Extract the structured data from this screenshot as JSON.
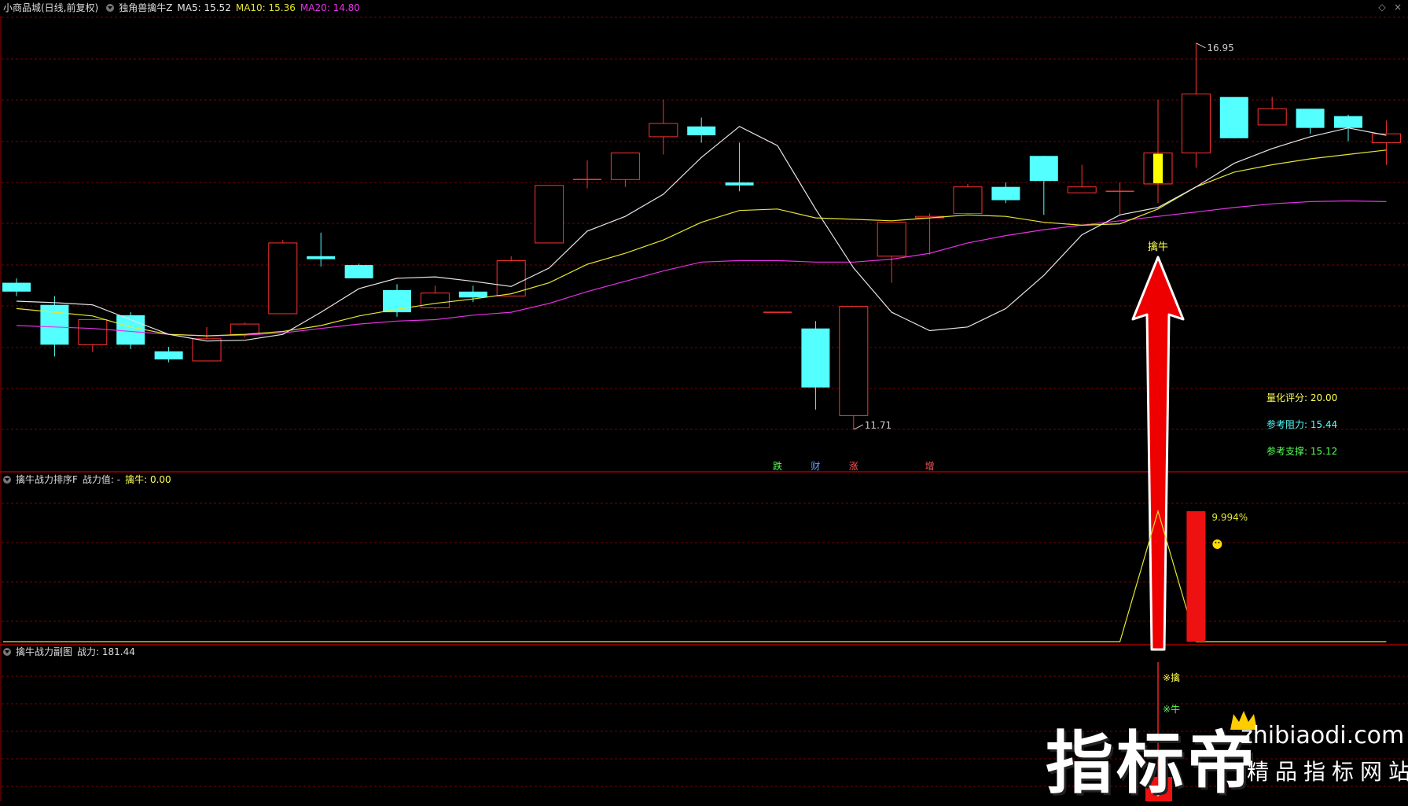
{
  "header": {
    "stock_name": "小商品城(日线,前复权)",
    "indicator_name": "独角兽擒牛Z",
    "ma5": "MA5: 15.52",
    "ma10": "MA10: 15.36",
    "ma20": "MA20: 14.80"
  },
  "panel2_header": {
    "name": "擒牛战力排序F",
    "value_label": "战力值: -",
    "qinniu_label": "擒牛: 0.00"
  },
  "panel3_header": {
    "name": "擒牛战力副图",
    "value_label": "战力: 181.44"
  },
  "price_labels": {
    "high": "16.95",
    "low": "11.71"
  },
  "signal_label": "擒牛",
  "event_labels": [
    "跌",
    "财",
    "涨",
    "增"
  ],
  "right_info": [
    {
      "label": "量化评分: 20.00",
      "color": "#ffff55"
    },
    {
      "label": "参考阻力: 15.44",
      "color": "#55ffff"
    },
    {
      "label": "参考支撑: 15.12",
      "color": "#55ff55"
    }
  ],
  "panel2_pct": "9.994%",
  "panel3_marks": [
    "※擒",
    "※牛"
  ],
  "watermark": {
    "main": "指标帝",
    "url": "zhibiaodi.com",
    "sub": "精品指标网站"
  },
  "colors": {
    "up": "#ff3232",
    "down": "#54ffff",
    "ma5": "#e6e6e6",
    "ma10": "#e6e632",
    "ma20": "#e632e6",
    "grid": "#7a0000",
    "signal": "#ffff00"
  },
  "chart_data": {
    "type": "candlestick",
    "candles": [
      {
        "o": 13.7,
        "h": 13.76,
        "l": 13.52,
        "c": 13.58
      },
      {
        "o": 13.4,
        "h": 13.52,
        "l": 12.7,
        "c": 12.86
      },
      {
        "o": 12.86,
        "h": 13.2,
        "l": 12.76,
        "c": 13.2
      },
      {
        "o": 13.26,
        "h": 13.3,
        "l": 12.8,
        "c": 12.86
      },
      {
        "o": 12.77,
        "h": 12.83,
        "l": 12.62,
        "c": 12.66
      },
      {
        "o": 12.64,
        "h": 13.1,
        "l": 12.64,
        "c": 12.94
      },
      {
        "o": 13.0,
        "h": 13.16,
        "l": 12.96,
        "c": 13.14
      },
      {
        "o": 13.28,
        "h": 14.28,
        "l": 13.28,
        "c": 14.24
      },
      {
        "o": 14.06,
        "h": 14.38,
        "l": 13.92,
        "c": 14.02
      },
      {
        "o": 13.94,
        "h": 13.96,
        "l": 13.76,
        "c": 13.76
      },
      {
        "o": 13.6,
        "h": 13.68,
        "l": 13.24,
        "c": 13.3
      },
      {
        "o": 13.36,
        "h": 13.66,
        "l": 13.34,
        "c": 13.56
      },
      {
        "o": 13.58,
        "h": 13.66,
        "l": 13.44,
        "c": 13.5
      },
      {
        "o": 13.52,
        "h": 14.06,
        "l": 13.52,
        "c": 14.0
      },
      {
        "o": 14.24,
        "h": 15.02,
        "l": 14.24,
        "c": 15.02
      },
      {
        "o": 15.1,
        "h": 15.36,
        "l": 14.98,
        "c": 15.1
      },
      {
        "o": 15.1,
        "h": 15.46,
        "l": 15.0,
        "c": 15.46
      },
      {
        "o": 15.68,
        "h": 16.18,
        "l": 15.44,
        "c": 15.86
      },
      {
        "o": 15.82,
        "h": 15.94,
        "l": 15.6,
        "c": 15.7
      },
      {
        "o": 15.06,
        "h": 15.6,
        "l": 14.94,
        "c": 15.02
      },
      {
        "o": 13.3,
        "h": 13.3,
        "l": 13.3,
        "c": 13.3
      },
      {
        "o": 13.08,
        "h": 13.18,
        "l": 11.98,
        "c": 12.28
      },
      {
        "o": 11.9,
        "h": 13.38,
        "l": 11.71,
        "c": 13.38
      },
      {
        "o": 14.06,
        "h": 14.52,
        "l": 13.7,
        "c": 14.52
      },
      {
        "o": 14.58,
        "h": 14.64,
        "l": 14.08,
        "c": 14.6
      },
      {
        "o": 14.64,
        "h": 15.04,
        "l": 14.64,
        "c": 15.0
      },
      {
        "o": 15.0,
        "h": 15.06,
        "l": 14.78,
        "c": 14.82
      },
      {
        "o": 15.42,
        "h": 15.42,
        "l": 14.62,
        "c": 15.08
      },
      {
        "o": 14.92,
        "h": 15.3,
        "l": 14.92,
        "c": 15.0
      },
      {
        "o": 14.94,
        "h": 15.06,
        "l": 14.62,
        "c": 14.94
      },
      {
        "o": 15.04,
        "h": 16.18,
        "l": 14.78,
        "c": 15.46
      },
      {
        "o": 15.46,
        "h": 16.95,
        "l": 15.26,
        "c": 16.26
      },
      {
        "o": 16.22,
        "h": 16.22,
        "l": 15.66,
        "c": 15.66
      },
      {
        "o": 15.84,
        "h": 16.22,
        "l": 15.84,
        "c": 16.06
      },
      {
        "o": 16.06,
        "h": 16.06,
        "l": 15.72,
        "c": 15.8
      },
      {
        "o": 15.96,
        "h": 15.98,
        "l": 15.62,
        "c": 15.8
      },
      {
        "o": 15.6,
        "h": 15.9,
        "l": 15.3,
        "c": 15.72
      }
    ],
    "ma5": [
      13.45,
      13.43,
      13.4,
      13.2,
      13.0,
      12.91,
      12.92,
      13.0,
      13.3,
      13.62,
      13.76,
      13.78,
      13.72,
      13.65,
      13.9,
      14.4,
      14.6,
      14.9,
      15.4,
      15.82,
      15.56,
      14.7,
      13.9,
      13.3,
      13.05,
      13.1,
      13.35,
      13.8,
      14.35,
      14.62,
      14.72,
      15.0,
      15.32,
      15.52,
      15.68,
      15.8,
      15.7
    ],
    "ma10": [
      13.35,
      13.3,
      13.25,
      13.1,
      13.0,
      12.98,
      13.0,
      13.04,
      13.12,
      13.25,
      13.34,
      13.42,
      13.48,
      13.55,
      13.7,
      13.95,
      14.1,
      14.28,
      14.52,
      14.68,
      14.7,
      14.58,
      14.56,
      14.54,
      14.58,
      14.62,
      14.6,
      14.52,
      14.48,
      14.5,
      14.7,
      15.0,
      15.2,
      15.3,
      15.38,
      15.44,
      15.5
    ],
    "ma20": [
      13.12,
      13.1,
      13.08,
      13.04,
      13.0,
      12.98,
      12.99,
      13.02,
      13.08,
      13.14,
      13.18,
      13.2,
      13.26,
      13.3,
      13.42,
      13.58,
      13.72,
      13.86,
      13.98,
      14.0,
      14.0,
      13.98,
      13.98,
      14.02,
      14.1,
      14.24,
      14.34,
      14.42,
      14.48,
      14.54,
      14.6,
      14.66,
      14.72,
      14.77,
      14.8,
      14.81,
      14.8
    ],
    "signal_index": 30,
    "sub1_line": [
      0,
      0,
      0,
      0,
      0,
      0,
      0,
      0,
      0,
      0,
      0,
      0,
      0,
      0,
      0,
      0,
      0,
      0,
      0,
      0,
      0,
      0,
      0,
      0,
      0,
      0,
      0,
      0,
      0,
      0,
      100,
      0,
      0,
      0,
      0,
      0,
      0
    ],
    "sub1_bar": {
      "index": 31,
      "value": 9.994
    },
    "ylim": [
      11.2,
      17.3
    ]
  }
}
